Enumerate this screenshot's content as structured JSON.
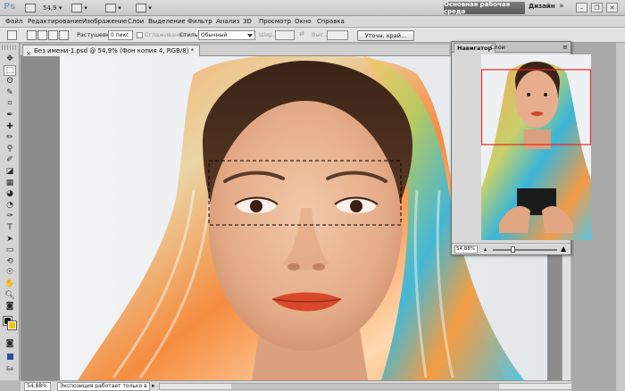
{
  "app": {
    "logo": "Ps",
    "zoom_value": "54,9",
    "workspace_active": "Основная рабочая среда",
    "workspace_other": "Дизайн",
    "workspace_more": "»",
    "win_minimize": "–",
    "win_restore": "❐",
    "win_close": "✕"
  },
  "menu": [
    "Файл",
    "Редактирование",
    "Изображение",
    "Слои",
    "Выделение",
    "Фильтр",
    "Анализ",
    "3D",
    "Просмотр",
    "Окно",
    "Справка"
  ],
  "options": {
    "feather_label": "Растушевка:",
    "feather_value": "0 пикс",
    "antialias_label": "Сглаживание",
    "style_label": "Стиль:",
    "style_value": "Обычный",
    "width_label": "Шир.:",
    "height_label": "Выс.:",
    "refine_edge_button": "Уточн. край..."
  },
  "document": {
    "tab_title": "Без имени-1.psd @ 54,9% (Фон копия 4, RGB/8) *",
    "close_glyph": "×"
  },
  "tools": [
    {
      "icon": "move-icon",
      "glyph": "✥"
    },
    {
      "icon": "marquee-icon",
      "glyph": "⬚",
      "active": true
    },
    {
      "icon": "lasso-icon",
      "glyph": "ʘ"
    },
    {
      "icon": "quick-select-icon",
      "glyph": "✎"
    },
    {
      "icon": "crop-icon",
      "glyph": "⌗"
    },
    {
      "icon": "eyedropper-icon",
      "glyph": "✒"
    },
    {
      "icon": "healing-icon",
      "glyph": "✚"
    },
    {
      "icon": "brush-icon",
      "glyph": "✏"
    },
    {
      "icon": "stamp-icon",
      "glyph": "⚲"
    },
    {
      "icon": "history-brush-icon",
      "glyph": "✐"
    },
    {
      "icon": "eraser-icon",
      "glyph": "◪"
    },
    {
      "icon": "gradient-icon",
      "glyph": "▦"
    },
    {
      "icon": "blur-icon",
      "glyph": "◕"
    },
    {
      "icon": "dodge-icon",
      "glyph": "◔"
    },
    {
      "icon": "pen-icon",
      "glyph": "✑"
    },
    {
      "icon": "type-icon",
      "glyph": "T"
    },
    {
      "icon": "path-select-icon",
      "glyph": "➤"
    },
    {
      "icon": "shape-icon",
      "glyph": "▭"
    },
    {
      "icon": "3d-rotate-icon",
      "glyph": "⟲"
    },
    {
      "icon": "3d-orbit-icon",
      "glyph": "☉"
    },
    {
      "icon": "hand-icon",
      "glyph": "✋"
    },
    {
      "icon": "zoom-icon",
      "glyph": "🔍︎"
    },
    {
      "icon": "quick-mask-icon",
      "glyph": "◙"
    }
  ],
  "tools_bottom": {
    "label": "Бе"
  },
  "status": {
    "zoom": "54,88%",
    "info": "Экспозиция работает только в ...",
    "arrow": "▸"
  },
  "navigator": {
    "tab_navigator": "Навигатор",
    "tab_layers": "Слои",
    "menu_glyph": "≡",
    "zoom": "54,88%",
    "zoom_out_glyph": "▴",
    "zoom_in_glyph": "▲",
    "slider_fraction": 0.3
  },
  "colors": {
    "workspace_active_bg": "#6b6b6b",
    "navigator_frame": "#e8241e",
    "foreground_swatch": "#111111",
    "background_swatch": "#f6c400"
  }
}
